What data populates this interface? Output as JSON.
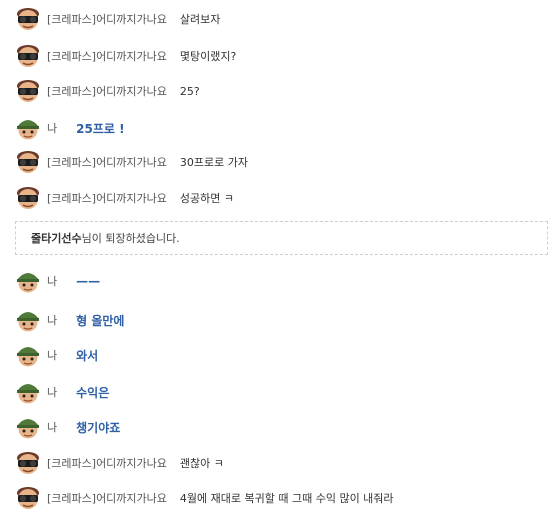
{
  "colors": {
    "my_message": "#2f5fa5",
    "name_text": "#555555",
    "notice_border": "#cfcfcf"
  },
  "messages": [
    {
      "sender": "[크레파스]어디까지가나요",
      "text": "살려보자",
      "mine": false
    },
    {
      "sender": "[크레파스]어디까지가나요",
      "text": "몇탕이랬지?",
      "mine": false
    },
    {
      "sender": "[크레파스]어디까지가나요",
      "text": "25?",
      "mine": false
    },
    {
      "sender": "나",
      "text": "25프로 !",
      "mine": true
    },
    {
      "sender": "[크레파스]어디까지가나요",
      "text": "30프로로 가자",
      "mine": false
    },
    {
      "sender": "[크레파스]어디까지가나요",
      "text": "성공하면 ㅋ",
      "mine": false
    },
    {
      "sender": "나",
      "text": "——",
      "mine": true
    },
    {
      "sender": "나",
      "text": "형 올만에",
      "mine": true
    },
    {
      "sender": "나",
      "text": "와서",
      "mine": true
    },
    {
      "sender": "나",
      "text": "수익은",
      "mine": true
    },
    {
      "sender": "나",
      "text": "챙기야죠",
      "mine": true
    },
    {
      "sender": "[크레파스]어디까지가나요",
      "text": "괜찮아 ㅋ",
      "mine": false
    },
    {
      "sender": "[크레파스]어디까지가나요",
      "text": "4월에 재대로 복귀할 때 그때 수익 많이 내줘라",
      "mine": false
    }
  ],
  "notice": {
    "nickname": "줄타기선수",
    "text": "님이 퇴장하셨습니다."
  },
  "icons": {
    "other_avatar": "sunglasses-character-avatar-icon",
    "my_avatar": "green-helmet-soldier-avatar-icon"
  }
}
